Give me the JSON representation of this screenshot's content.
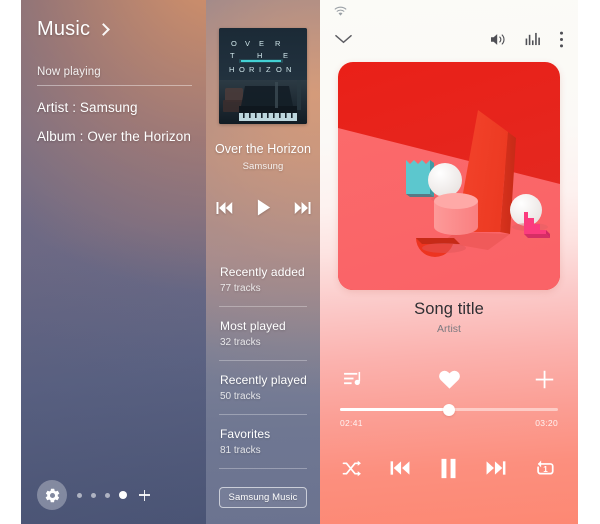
{
  "left_widget": {
    "title": "Music",
    "chevron_icon": "chevron-right-icon",
    "now_playing_label": "Now playing",
    "artist_line": "Artist : Samsung",
    "album_line": "Album : Over the Horizon",
    "dock": {
      "settings_icon": "gear-icon",
      "add_icon": "plus-icon",
      "page_dots": 4,
      "active_dot_index": 4
    }
  },
  "mid_player": {
    "album_art_icon": "album-art-over-the-horizon",
    "album_art_text": [
      "O",
      "V",
      "E",
      "R",
      "T",
      "H",
      "E",
      "H",
      "O",
      "R",
      "I",
      "Z",
      "O",
      "N"
    ],
    "song_title": "Over the Horizon",
    "artist": "Samsung",
    "controls": {
      "previous_icon": "previous-track-icon",
      "play_icon": "play-icon",
      "next_icon": "next-track-icon"
    },
    "lists": [
      {
        "title": "Recently added",
        "subtitle": "77 tracks"
      },
      {
        "title": "Most played",
        "subtitle": "32 tracks"
      },
      {
        "title": "Recently played",
        "subtitle": "50 tracks"
      },
      {
        "title": "Favorites",
        "subtitle": "81 tracks"
      }
    ],
    "app_button_label": "Samsung Music"
  },
  "right_player": {
    "status_bar": {
      "wifi_icon": "wifi-icon"
    },
    "topbar": {
      "collapse_icon": "chevron-down-icon",
      "volume_icon": "volume-speaker-icon",
      "equalizer_icon": "equalizer-icon",
      "overflow_icon": "more-vertical-icon"
    },
    "album_art_icon": "album-art-red-shapes",
    "song_title": "Song title",
    "artist": "Artist",
    "actions": {
      "queue_icon": "playlist-queue-icon",
      "favorite_icon": "heart-icon",
      "add_icon": "plus-icon"
    },
    "seek": {
      "elapsed": "02:41",
      "total": "03:20",
      "progress_percent": 50
    },
    "transport": {
      "shuffle_icon": "shuffle-icon",
      "previous_icon": "previous-track-icon",
      "pause_icon": "pause-icon",
      "next_icon": "next-track-icon",
      "repeat_icon": "repeat-one-icon"
    }
  },
  "colors": {
    "right_accent_red": "#e8251c",
    "right_bg_bottom": "#fd8873",
    "left_panel_blue": "#5f6686",
    "left_panel_warm": "#e09666"
  }
}
